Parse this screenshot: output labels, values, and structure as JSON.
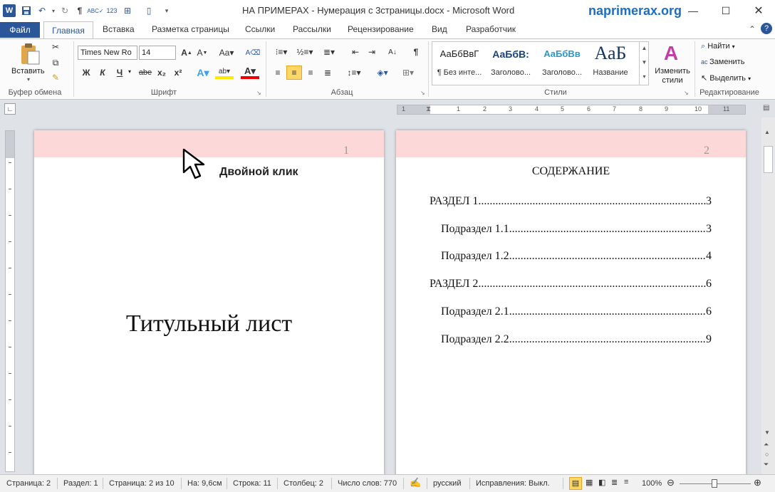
{
  "window": {
    "title": "НА ПРИМЕРАХ - Нумерация с 3страницы.docx - Microsoft Word",
    "site": "naprimerax.org",
    "app_icon": "W"
  },
  "tabs": [
    "Файл",
    "Главная",
    "Вставка",
    "Разметка страницы",
    "Ссылки",
    "Рассылки",
    "Рецензирование",
    "Вид",
    "Разработчик"
  ],
  "ribbon": {
    "clipboard": {
      "paste_label": "Вставить",
      "group": "Буфер обмена"
    },
    "font": {
      "name": "Times New Ro",
      "size": "14",
      "group": "Шрифт",
      "bold": "Ж",
      "italic": "К",
      "underline": "Ч",
      "strike": "abe",
      "sub": "x₂",
      "sup": "x²"
    },
    "paragraph": {
      "group": "Абзац"
    },
    "styles": {
      "group": "Стили",
      "items": [
        {
          "sample": "АаБбВвГ",
          "name": "¶ Без инте..."
        },
        {
          "sample": "АаБбВ:",
          "name": "Заголово..."
        },
        {
          "sample": "АаБбВв",
          "name": "Заголово..."
        },
        {
          "sample": "АаБ",
          "name": "Название"
        }
      ],
      "change_label": "Изменить",
      "change_label2": "стили"
    },
    "editing": {
      "group": "Редактирование",
      "find": "Найти",
      "replace": "Заменить",
      "select": "Выделить"
    }
  },
  "ruler": {
    "marks": [
      "1",
      "2",
      "1",
      "2",
      "3",
      "4",
      "5",
      "6",
      "7",
      "8",
      "9",
      "10",
      "11"
    ]
  },
  "page1": {
    "header_num": "1",
    "title": "Титульный лист",
    "annotation": "Двойной клик"
  },
  "page2": {
    "header_num": "2",
    "heading": "СОДЕРЖАНИЕ",
    "toc": [
      {
        "text": "РАЗДЕЛ 1",
        "page": "3",
        "indent": false
      },
      {
        "text": "Подраздел 1.1",
        "page": "3",
        "indent": true
      },
      {
        "text": "Подраздел 1.2",
        "page": "4",
        "indent": true
      },
      {
        "text": "РАЗДЕЛ 2",
        "page": "6",
        "indent": false
      },
      {
        "text": "Подраздел 2.1",
        "page": "6",
        "indent": true
      },
      {
        "text": "Подраздел 2.2",
        "page": "9",
        "indent": true
      }
    ]
  },
  "status": {
    "page": "Страница: 2",
    "section": "Раздел: 1",
    "page_of": "Страница: 2 из 10",
    "at": "На: 9,6см",
    "line": "Строка: 11",
    "column": "Столбец: 2",
    "words": "Число слов: 770",
    "lang": "русский",
    "track": "Исправления: Выкл.",
    "zoom": "100%"
  }
}
